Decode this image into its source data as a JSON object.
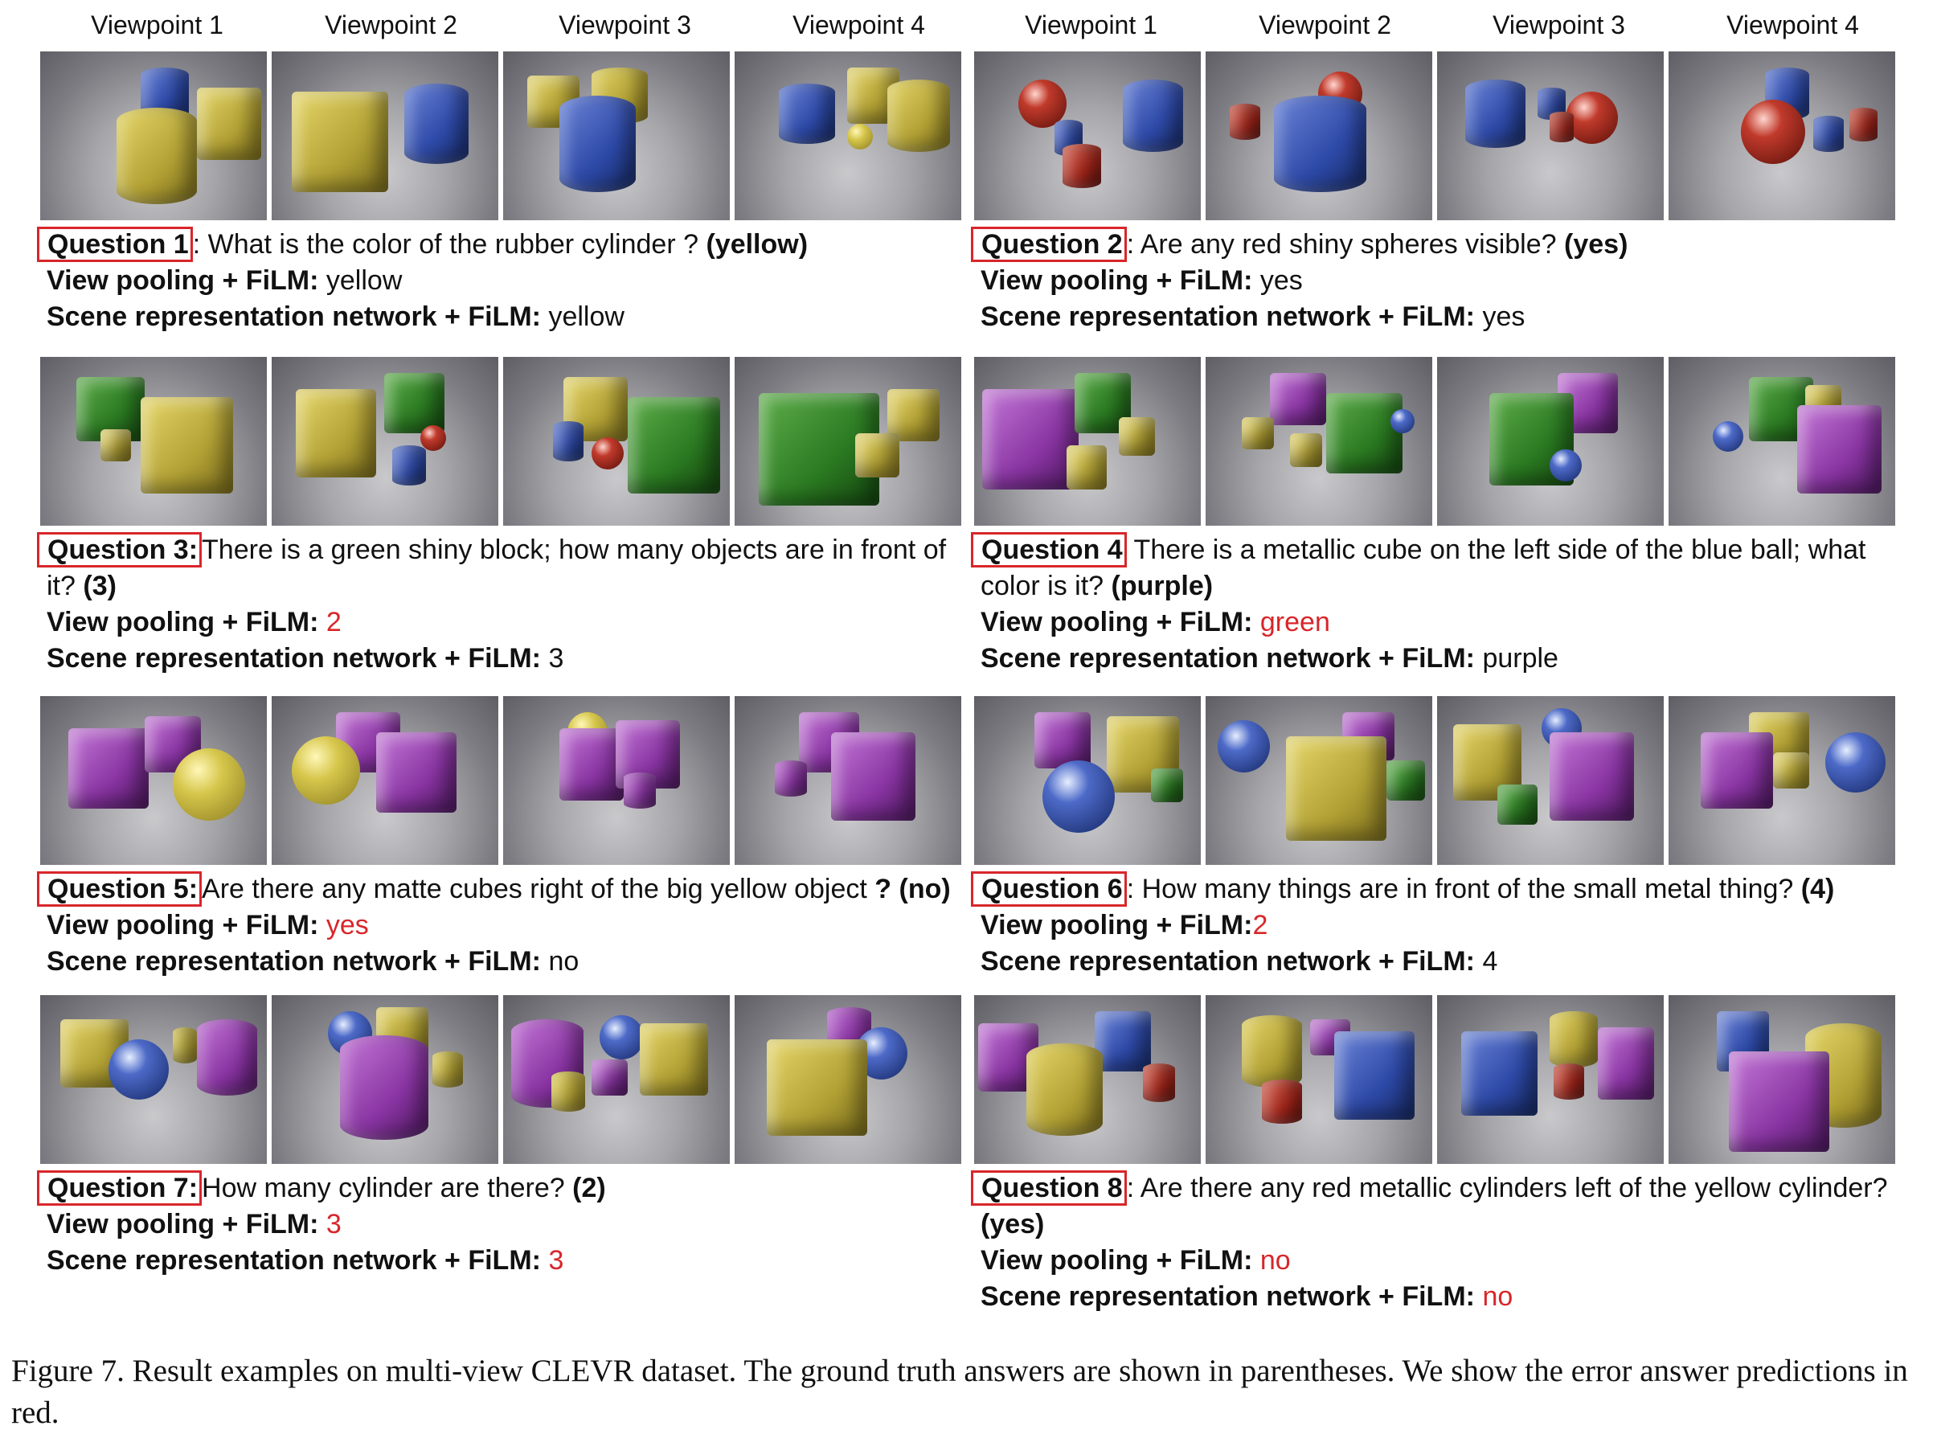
{
  "viewpoints_left": [
    "Viewpoint 1",
    "Viewpoint 2",
    "Viewpoint 3",
    "Viewpoint 4"
  ],
  "viewpoints_right": [
    "Viewpoint 1",
    "Viewpoint 2",
    "Viewpoint 3",
    "Viewpoint 4"
  ],
  "method_view_pooling": "View pooling + FiLM:",
  "method_scene_rep": "Scene representation network + FiLM:",
  "questions": [
    {
      "label": "Question 1",
      "sep": ":",
      "text": "What is the color of the rubber cylinder ?",
      "gt": "(yellow)",
      "view_pooling_answer": "yellow",
      "view_pooling_error": false,
      "scene_rep_answer": "yellow",
      "scene_rep_error": false
    },
    {
      "label": "Question 2",
      "sep": ":",
      "text": "Are any red shiny spheres visible?",
      "gt": "(yes)",
      "view_pooling_answer": "yes",
      "view_pooling_error": false,
      "scene_rep_answer": "yes",
      "scene_rep_error": false
    },
    {
      "label": "Question 3:",
      "sep": "",
      "text": "There is a green shiny block; how many objects are in front of it?",
      "gt": "(3)",
      "view_pooling_answer": "2",
      "view_pooling_error": true,
      "scene_rep_answer": "3",
      "scene_rep_error": false
    },
    {
      "label": "Question 4",
      "sep": "",
      "text": "There is a metallic cube on the left side of the blue ball; what color is it?",
      "gt": "(purple)",
      "view_pooling_answer": "green",
      "view_pooling_error": true,
      "scene_rep_answer": "purple",
      "scene_rep_error": false
    },
    {
      "label": "Question 5:",
      "sep": "",
      "text": "Are there any matte cubes right of the big yellow object",
      "gt": "? (no)",
      "view_pooling_answer": "yes",
      "view_pooling_error": true,
      "scene_rep_answer": "no",
      "scene_rep_error": false
    },
    {
      "label": "Question 6",
      "sep": ":",
      "text": "How many things are in front of the small metal thing?",
      "gt": "(4)",
      "view_pooling_answer": "2",
      "view_pooling_error": true,
      "scene_rep_answer": "4",
      "scene_rep_error": false
    },
    {
      "label": "Question 7:",
      "sep": "",
      "text": "How many cylinder are there?",
      "gt": "(2)",
      "view_pooling_answer": "3",
      "view_pooling_error": true,
      "scene_rep_answer": "3",
      "scene_rep_error": true
    },
    {
      "label": "Question 8",
      "sep": ":",
      "text": "Are there any red metallic cylinders left of the yellow cylinder?",
      "gt": "(yes)",
      "view_pooling_answer": "no",
      "view_pooling_error": true,
      "scene_rep_answer": "no",
      "scene_rep_error": true
    }
  ],
  "caption": "Figure 7. Result examples on multi-view CLEVR dataset. The ground truth answers are shown in parentheses. We show the error answer predictions in red.",
  "colors": {
    "error": "#d8262a",
    "question_box": "#d8262a"
  }
}
